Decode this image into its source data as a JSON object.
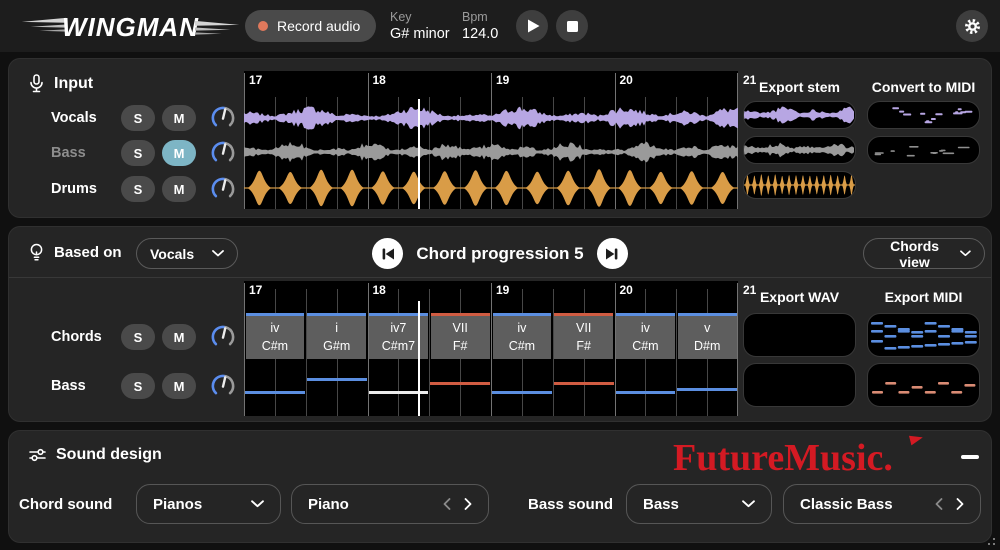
{
  "topbar": {
    "logo": "WINGMAN",
    "record_label": "Record audio",
    "key_label": "Key",
    "key_value": "G# minor",
    "bpm_label": "Bpm",
    "bpm_value": "124.0"
  },
  "input_panel": {
    "title": "Input",
    "tracks": [
      {
        "label": "Vocals",
        "solo": "S",
        "mute": "M",
        "muted": false
      },
      {
        "label": "Bass",
        "solo": "S",
        "mute": "M",
        "muted": true
      },
      {
        "label": "Drums",
        "solo": "S",
        "mute": "M",
        "muted": false
      }
    ],
    "export_stem_label": "Export stem",
    "convert_midi_label": "Convert to MIDI"
  },
  "timeline": {
    "bars": [
      "17",
      "18",
      "19",
      "20",
      "21"
    ],
    "beats_per_bar": 4,
    "playhead_fraction": 0.354
  },
  "progression_panel": {
    "based_on_label": "Based on",
    "based_on_value": "Vocals",
    "title": "Chord progression 5",
    "view_label": "Chords view",
    "tracks": [
      {
        "label": "Chords",
        "solo": "S",
        "mute": "M"
      },
      {
        "label": "Bass",
        "solo": "S",
        "mute": "M"
      }
    ],
    "export_wav_label": "Export WAV",
    "export_midi_label": "Export MIDI",
    "chords": [
      {
        "roman": "iv",
        "name": "C#m",
        "color": "blue"
      },
      {
        "roman": "i",
        "name": "G#m",
        "color": "blue"
      },
      {
        "roman": "iv7",
        "name": "C#m7",
        "color": "blue"
      },
      {
        "roman": "VII",
        "name": "F#",
        "color": "red"
      },
      {
        "roman": "iv",
        "name": "C#m",
        "color": "blue"
      },
      {
        "roman": "VII",
        "name": "F#",
        "color": "red"
      },
      {
        "roman": "iv",
        "name": "C#m",
        "color": "blue"
      },
      {
        "roman": "v",
        "name": "D#m",
        "color": "blue"
      }
    ],
    "bass_notes": [
      {
        "level": "low",
        "color": "blue"
      },
      {
        "level": "high",
        "color": "blue"
      },
      {
        "level": "low",
        "color": "white"
      },
      {
        "level": "mid",
        "color": "red"
      },
      {
        "level": "low",
        "color": "blue"
      },
      {
        "level": "mid",
        "color": "red"
      },
      {
        "level": "low",
        "color": "blue"
      },
      {
        "level": "mid-low",
        "color": "blue"
      }
    ]
  },
  "sound_panel": {
    "title": "Sound design",
    "chord_sound_label": "Chord sound",
    "chord_category": "Pianos",
    "chord_preset": "Piano",
    "bass_sound_label": "Bass sound",
    "bass_category": "Bass",
    "bass_preset": "Classic Bass",
    "watermark": "FutureMusic."
  },
  "colors": {
    "record_dot": "#e0795c",
    "mute_active": "#7db5c5",
    "knob_accent": "#5b8def",
    "vocals": "#b7a6e3",
    "bass_wave": "#9a9a9a",
    "drums": "#d99c47",
    "blue": "#5b8ee0",
    "red": "#d05c42",
    "midi_bass": "#d98b74",
    "watermark": "#d41a23"
  }
}
